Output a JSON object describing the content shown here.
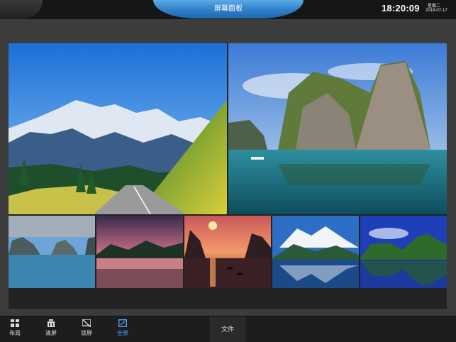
{
  "header": {
    "title": "屏幕面板",
    "time": "18:20:09",
    "weekday": "星期二",
    "date": "2018-07-17"
  },
  "toolbar": {
    "items": [
      {
        "label": "布局",
        "icon": "layout-grid-icon",
        "active": false
      },
      {
        "label": "清屏",
        "icon": "clear-screen-icon",
        "active": false
      },
      {
        "label": "锁屏",
        "icon": "lock-screen-icon",
        "active": false
      },
      {
        "label": "全景",
        "icon": "panorama-icon",
        "active": true
      }
    ],
    "file_label": "文件"
  },
  "colors": {
    "accent": "#2e7fc9",
    "active_tool": "#4aa3ff"
  },
  "screens": [
    {
      "name": "mountain-road"
    },
    {
      "name": "karst-island"
    },
    {
      "name": "rocky-bay"
    },
    {
      "name": "pink-sunset-lake"
    },
    {
      "name": "sunset-boats"
    },
    {
      "name": "snowy-peak-lake"
    },
    {
      "name": "green-hill-reflection"
    }
  ]
}
